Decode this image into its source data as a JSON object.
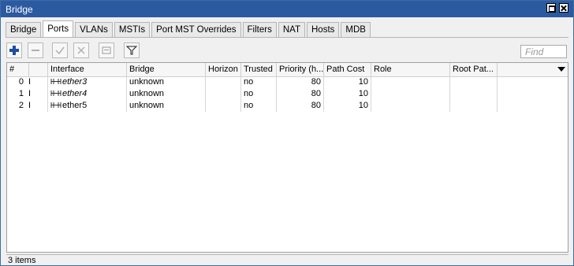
{
  "window": {
    "title": "Bridge"
  },
  "tabs": [
    {
      "label": "Bridge",
      "active": false
    },
    {
      "label": "Ports",
      "active": true
    },
    {
      "label": "VLANs",
      "active": false
    },
    {
      "label": "MSTIs",
      "active": false
    },
    {
      "label": "Port MST Overrides",
      "active": false
    },
    {
      "label": "Filters",
      "active": false
    },
    {
      "label": "NAT",
      "active": false
    },
    {
      "label": "Hosts",
      "active": false
    },
    {
      "label": "MDB",
      "active": false
    }
  ],
  "toolbar": {
    "buttons": [
      {
        "icon": "plus-icon",
        "enabled": true
      },
      {
        "icon": "minus-icon",
        "enabled": false
      },
      {
        "icon": "check-icon",
        "enabled": false
      },
      {
        "icon": "cross-icon",
        "enabled": false
      },
      {
        "icon": "comment-icon",
        "enabled": false
      },
      {
        "icon": "filter-icon",
        "enabled": true
      }
    ],
    "find_placeholder": "Find"
  },
  "table": {
    "headers": [
      "#",
      "",
      "Interface",
      "Bridge",
      "Horizon",
      "Trusted",
      "Priority (h...",
      "Path Cost",
      "Role",
      "Root Pat..."
    ],
    "rows": [
      {
        "num": "0",
        "flag": "I",
        "interface": "ether3",
        "bridge": "unknown",
        "horizon": "",
        "trusted": "no",
        "priority": "80",
        "path_cost": "10",
        "role": "",
        "root_path": ""
      },
      {
        "num": "1",
        "flag": "I",
        "interface": "ether4",
        "bridge": "unknown",
        "horizon": "",
        "trusted": "no",
        "priority": "80",
        "path_cost": "10",
        "role": "",
        "root_path": ""
      },
      {
        "num": "2",
        "flag": "I",
        "interface": "ether5",
        "bridge": "unknown",
        "horizon": "",
        "trusted": "no",
        "priority": "80",
        "path_cost": "10",
        "role": "",
        "root_path": ""
      }
    ]
  },
  "status": {
    "items": "3 items"
  },
  "colors": {
    "titlebar": "#2c5aa0",
    "accent": "#1b4fa0"
  }
}
